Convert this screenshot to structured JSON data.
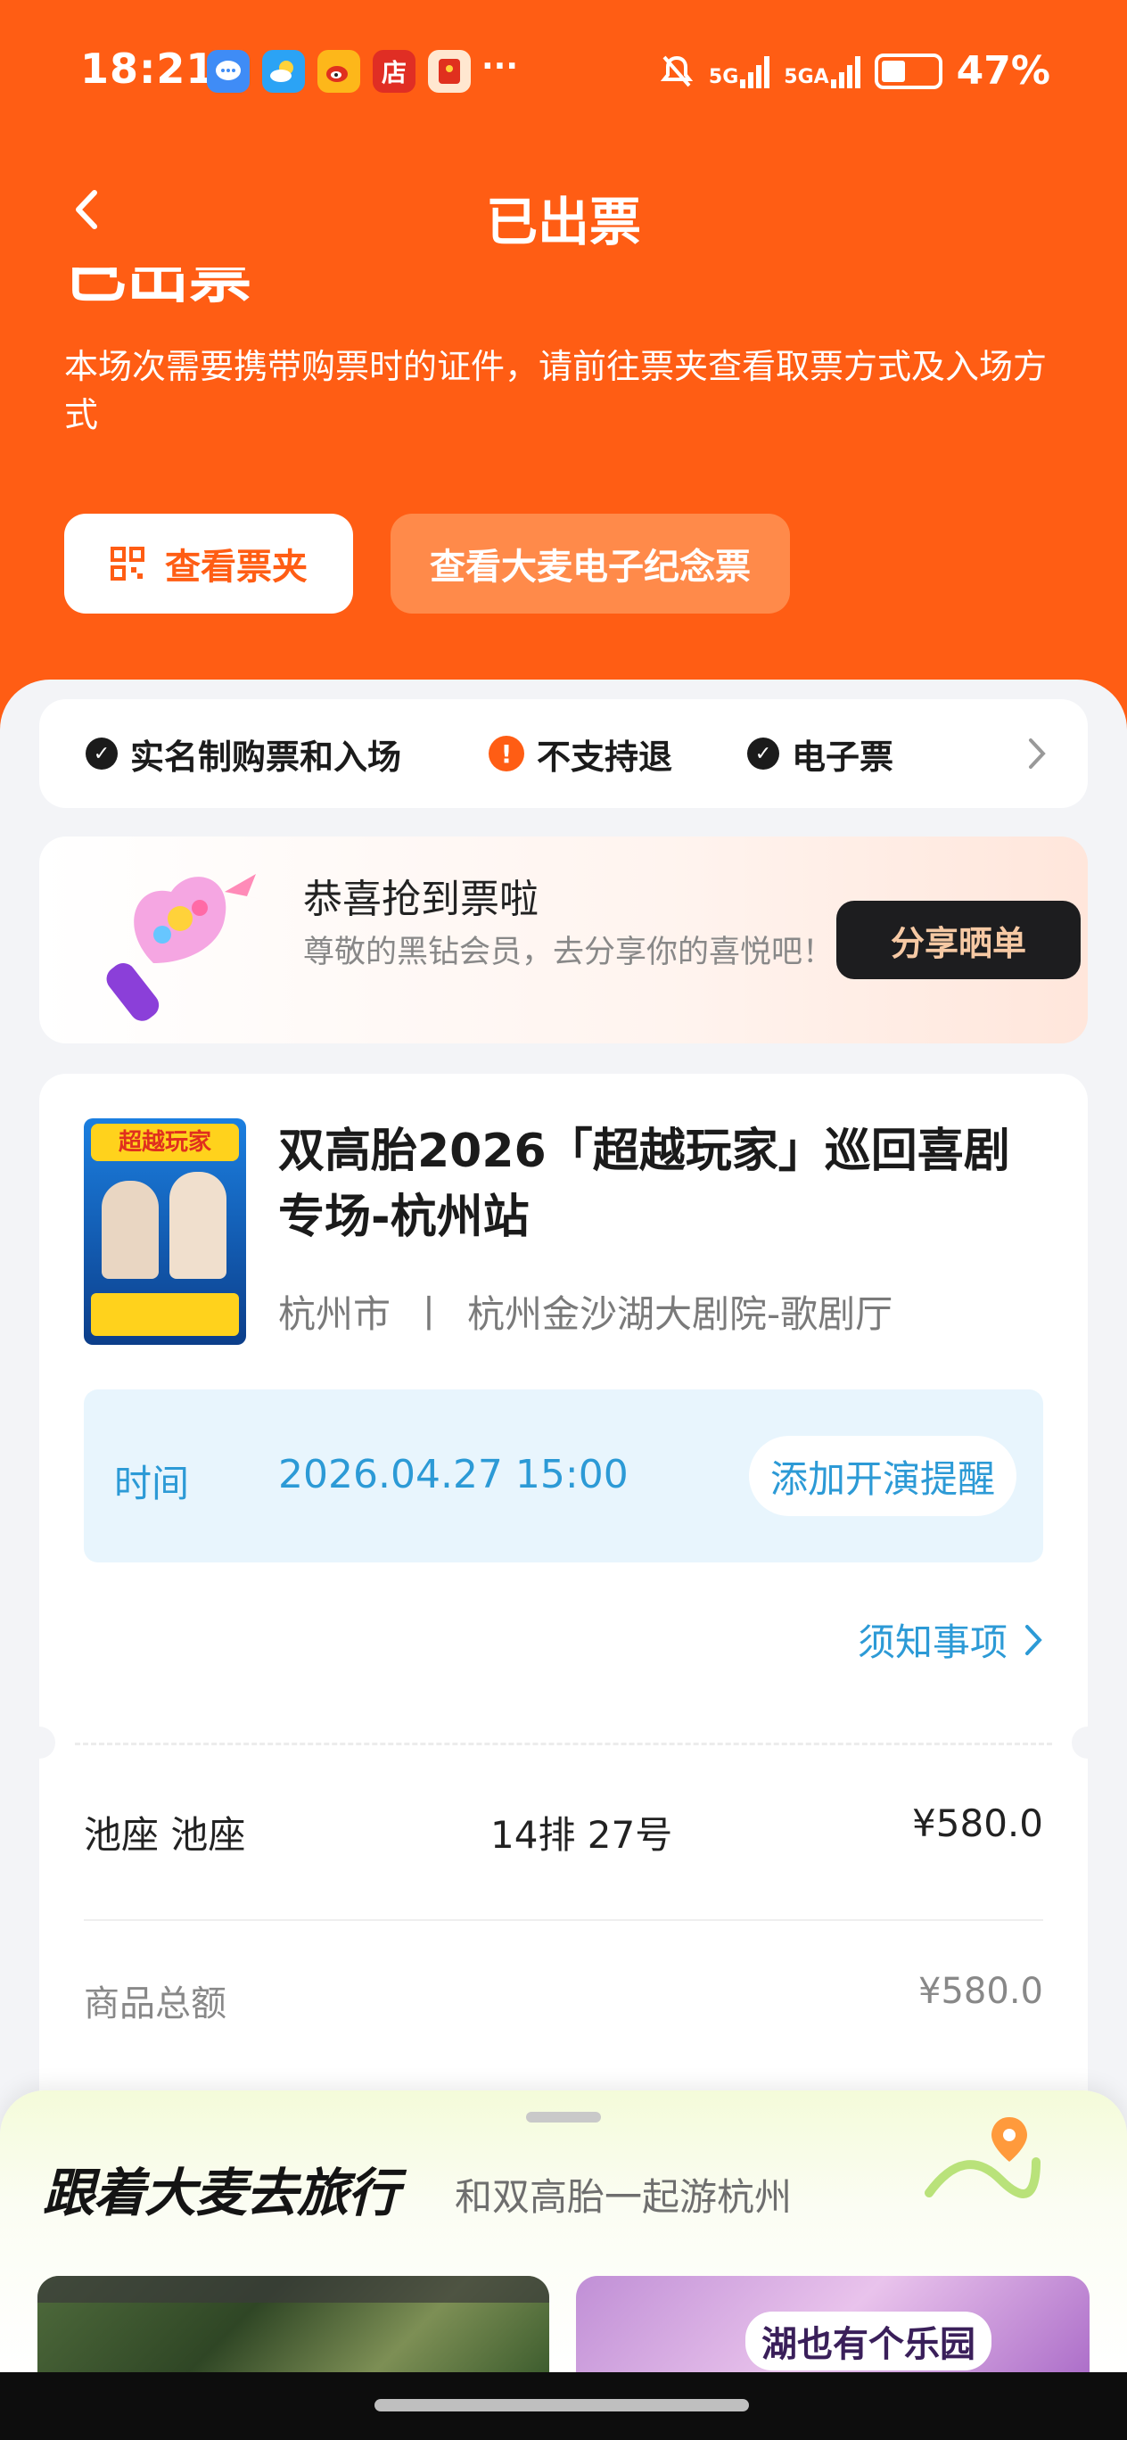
{
  "status_bar": {
    "time": "18:21",
    "more": "···",
    "network_1": "5G",
    "network_2": "5GA",
    "battery": "47%",
    "notification_icons": [
      "message-icon",
      "weather-icon",
      "weibo-icon",
      "shop-icon",
      "red-packet-icon"
    ],
    "shop_glyph": "店"
  },
  "nav": {
    "title": "已出票"
  },
  "status_heading": "已出票",
  "notice": "本场次需要携带购票时的证件，请前往票夹查看取票方式及入场方式",
  "actions": {
    "view_wallet": "查看票夹",
    "view_souvenir": "查看大麦电子纪念票"
  },
  "features": [
    {
      "label": "实名制购票和入场",
      "icon": "check-icon"
    },
    {
      "label": "不支持退",
      "icon": "warning-icon"
    },
    {
      "label": "电子票",
      "icon": "check-icon"
    }
  ],
  "promo": {
    "title": "恭喜抢到票啦",
    "subtitle": "尊敬的黑钻会员，去分享你的喜悦吧！",
    "button": "分享晒单"
  },
  "show": {
    "poster_title": "超越玩家",
    "title": "双高胎2026「超越玩家」巡回喜剧专场-杭州站",
    "city": "杭州市",
    "separator": "丨",
    "venue": "杭州金沙湖大剧院-歌剧厅",
    "time_label": "时间",
    "time_value": "2026.04.27 15:00",
    "reminder_button": "添加开演提醒",
    "notes_link": "须知事项"
  },
  "ticket": {
    "area": "池座 池座",
    "seat": "14排 27号",
    "price": "¥580.0",
    "total_label": "商品总额",
    "total_value": "¥580.0"
  },
  "travel": {
    "title": "跟着大麦去旅行",
    "subtitle": "和双高胎一起游杭州",
    "right_image_text": "湖也有个乐园"
  },
  "colors": {
    "brand_orange": "#ff5d14",
    "link_blue": "#2c9ad6",
    "share_button_bg": "#1d1d1f"
  }
}
